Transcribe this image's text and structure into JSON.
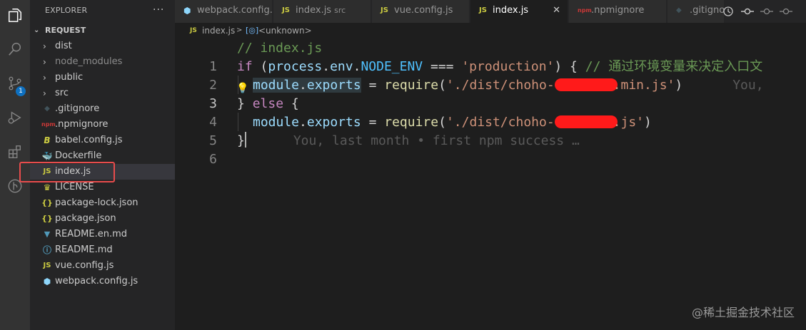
{
  "sidebar": {
    "title": "EXPLORER",
    "more": "···",
    "section": "REQUEST",
    "items": [
      {
        "label": "dist",
        "type": "folder"
      },
      {
        "label": "node_modules",
        "type": "folder"
      },
      {
        "label": "public",
        "type": "folder"
      },
      {
        "label": "src",
        "type": "folder"
      },
      {
        "label": ".gitignore",
        "type": "git"
      },
      {
        "label": ".npmignore",
        "type": "npm"
      },
      {
        "label": "babel.config.js",
        "type": "babel"
      },
      {
        "label": "Dockerfile",
        "type": "docker"
      },
      {
        "label": "index.js",
        "type": "js"
      },
      {
        "label": "LICENSE",
        "type": "license"
      },
      {
        "label": "package-lock.json",
        "type": "json"
      },
      {
        "label": "package.json",
        "type": "json"
      },
      {
        "label": "README.en.md",
        "type": "md"
      },
      {
        "label": "README.md",
        "type": "info"
      },
      {
        "label": "vue.config.js",
        "type": "js"
      },
      {
        "label": "webpack.config.js",
        "type": "webpack"
      }
    ]
  },
  "activity": {
    "scm_badge": "1"
  },
  "tabs": [
    {
      "label": "webpack.config.js",
      "desc": "",
      "icon": "webpack-icon"
    },
    {
      "label": "index.js",
      "desc": "src",
      "icon": "js-icon"
    },
    {
      "label": "vue.config.js",
      "desc": "",
      "icon": "js-icon"
    },
    {
      "label": "index.js",
      "desc": "",
      "icon": "js-icon",
      "close": "✕"
    },
    {
      "label": ".npmignore",
      "desc": "",
      "icon": "npm-icon"
    },
    {
      "label": ".gitignore",
      "desc": "",
      "icon": "git-icon"
    }
  ],
  "breadcrumb": {
    "file": "index.js",
    "separator": ">",
    "symbol": "<unknown>"
  },
  "editor": {
    "line_numbers": [
      "1",
      "2",
      "3",
      "4",
      "5",
      "6"
    ],
    "line1": "// index.js",
    "line2": {
      "kw": "if",
      "open": " (",
      "obj": "process",
      "dot1": ".",
      "env": "env",
      "dot2": ".",
      "const": "NODE_ENV",
      "op": " === ",
      "str": "'production'",
      "close": ") { ",
      "comment": "// 通过环境变量来决定入口文"
    },
    "line3": {
      "module": "module",
      "dot": ".",
      "exports": "exports",
      "eq": " = ",
      "fn": "require",
      "paren": "(",
      "str_a": "'./dist/choho-",
      "str_b": ".min.js'",
      "end": ")",
      "blame": "You,"
    },
    "line4": {
      "brace": "} ",
      "kw": "else",
      "open": " {"
    },
    "line5": {
      "module": "module",
      "dot": ".",
      "exports": "exports",
      "eq": " = ",
      "fn": "require",
      "paren": "(",
      "str_a": "'./dist/choho-",
      "str_b": ".js'",
      "end": ")"
    },
    "line6": {
      "brace": "}",
      "blame": "You, last month • first npm success …"
    }
  },
  "watermark": "@稀土掘金技术社区",
  "colors": {
    "accent": "#0e70c0",
    "highlight_box": "#e84c4c",
    "redaction": "#ff1a1a"
  }
}
